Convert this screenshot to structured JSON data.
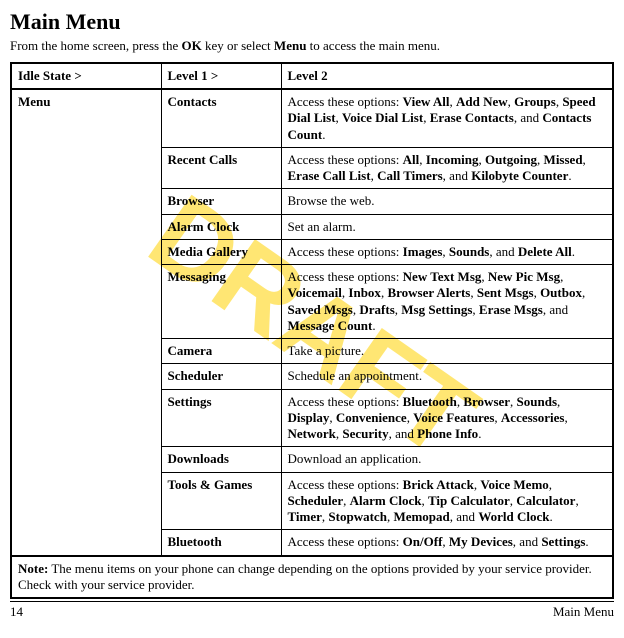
{
  "title": "Main Menu",
  "intro_before": "From the home screen, press the ",
  "intro_ok": "OK",
  "intro_mid": " key or select ",
  "intro_menu": "Menu",
  "intro_after": " to access the main menu.",
  "header": {
    "c1": "Idle State >",
    "c2": "Level 1 >",
    "c3": "Level 2"
  },
  "idle_label": "Menu",
  "rows": {
    "contacts": {
      "l1": "Contacts",
      "pre": "Access these options: ",
      "opts": [
        "View All",
        "Add New",
        "Groups",
        "Speed Dial List",
        "Voice Dial List",
        "Erase Contacts",
        "Contacts Count"
      ]
    },
    "recent": {
      "l1": "Recent Calls",
      "pre": "Access these options: ",
      "opts": [
        "All",
        "Incoming",
        "Outgoing",
        "Missed",
        "Erase Call List",
        "Call Timers",
        "Kilobyte Counter"
      ]
    },
    "browser": {
      "l1": "Browser",
      "text": "Browse the web."
    },
    "alarm": {
      "l1": "Alarm Clock",
      "text": "Set an alarm."
    },
    "media": {
      "l1": "Media Gallery",
      "pre": "Access these options: ",
      "opts": [
        "Images",
        "Sounds",
        "Delete All"
      ]
    },
    "messaging": {
      "l1": "Messaging",
      "pre": "Access these options: ",
      "opts": [
        "New Text Msg",
        "New Pic Msg",
        "Voicemail",
        "Inbox",
        "Browser Alerts",
        "Sent Msgs",
        "Outbox",
        "Saved Msgs",
        "Drafts",
        "Msg Settings",
        "Erase Msgs",
        "Message Count"
      ]
    },
    "camera": {
      "l1": "Camera",
      "text": "Take a picture."
    },
    "scheduler": {
      "l1": "Scheduler",
      "text": "Schedule an appointment."
    },
    "settings": {
      "l1": "Settings",
      "pre": "Access these options: ",
      "opts": [
        "Bluetooth",
        "Browser",
        "Sounds",
        "Display",
        "Convenience",
        "Voice Features",
        "Accessories",
        "Network",
        "Security",
        "Phone Info"
      ]
    },
    "downloads": {
      "l1": "Downloads",
      "text": "Download an application."
    },
    "tools": {
      "l1": "Tools & Games",
      "pre": "Access these options: ",
      "opts": [
        "Brick Attack",
        "Voice Memo",
        "Scheduler",
        "Alarm Clock",
        "Tip Calculator",
        "Calculator",
        "Timer",
        "Stopwatch",
        "Memopad",
        "World Clock"
      ]
    },
    "bluetooth": {
      "l1": "Bluetooth",
      "pre": "Access these options: ",
      "opts": [
        "On/Off",
        "My Devices",
        "Settings"
      ]
    }
  },
  "note_label": "Note:",
  "note_text": " The menu items on your phone can change depending on the options provided by your service provider. Check with your service provider.",
  "page_number": "14",
  "footer_right": "Main Menu",
  "watermark": "DRAFT"
}
